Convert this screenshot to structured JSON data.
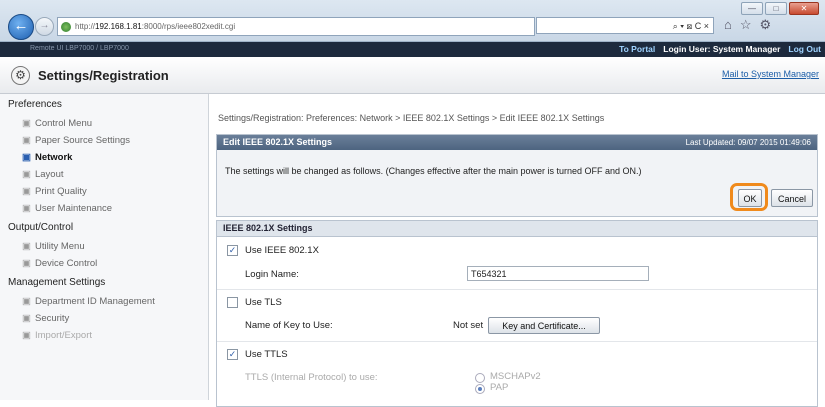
{
  "browser": {
    "url_prefix": "http://",
    "url_host": "192.168.1.81",
    "url_path": ":8000/rps/ieee802xedit.cgi",
    "search_text": "⌕ ▾ ⊠ C ×",
    "home_icon": "home-icon",
    "star_icon": "star-icon",
    "gear_icon": "gear-icon"
  },
  "header": {
    "device_text": "Remote UI     LBP7000 / LBP7000",
    "to_portal": "To Portal",
    "login_user": "Login User: System Manager",
    "log_out": "Log Out",
    "page_title": "Settings/Registration",
    "mail_to": "Mail to System Manager"
  },
  "sidebar": {
    "groups": [
      {
        "title": "Preferences",
        "items": [
          "Control Menu",
          "Paper Source Settings",
          "Network",
          "Layout",
          "Print Quality",
          "User Maintenance"
        ]
      },
      {
        "title": "Output/Control",
        "items": [
          "Utility Menu",
          "Device Control"
        ]
      },
      {
        "title": "Management Settings",
        "items": [
          "Department ID Management",
          "Security",
          "Import/Export"
        ]
      }
    ],
    "active_item": "Network"
  },
  "main": {
    "breadcrumb": "Settings/Registration: Preferences: Network > IEEE 802.1X Settings > Edit IEEE 802.1X Settings",
    "edit_panel": {
      "title": "Edit IEEE 802.1X Settings",
      "last_updated": "Last Updated: 09/07 2015 01:49:06",
      "message": "The settings will be changed as follows. (Changes effective after the main power is turned OFF and ON.)",
      "ok_label": "OK",
      "cancel_label": "Cancel"
    },
    "settings_panel": {
      "title": "IEEE 802.1X Settings",
      "use_ieee": {
        "label": "Use IEEE 802.1X",
        "checked": true
      },
      "login_name_label": "Login Name:",
      "login_name_value": "T654321",
      "use_tls": {
        "label": "Use TLS",
        "checked": false
      },
      "key_label": "Name of Key to Use:",
      "key_value": "Not set",
      "key_button": "Key and Certificate...",
      "use_ttls": {
        "label": "Use TTLS",
        "checked": true
      },
      "ttls_label": "TTLS (Internal Protocol) to use:",
      "ttls_options": [
        "MSCHAPv2",
        "PAP"
      ],
      "ttls_selected": "PAP"
    }
  },
  "colors": {
    "accent_orange": "#f08a1c",
    "header_dark": "#1d2a3d",
    "link_blue": "#1d5fa8"
  }
}
